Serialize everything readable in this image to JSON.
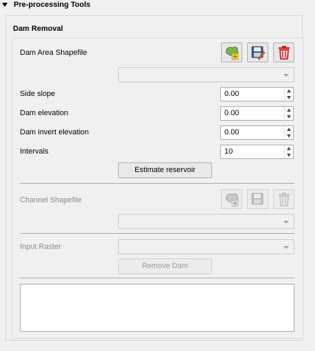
{
  "header": {
    "title": "Pre-processing Tools"
  },
  "group": {
    "title": "Dam Removal"
  },
  "dam_area": {
    "label": "Dam Area Shapefile",
    "combo_value": "",
    "icons": [
      "add-shapefile-icon",
      "save-shapefile-icon",
      "delete-icon"
    ]
  },
  "fields": [
    {
      "label": "Side slope",
      "value": "0.00"
    },
    {
      "label": "Dam elevation",
      "value": "0.00"
    },
    {
      "label": "Dam invert elevation",
      "value": "0.00"
    },
    {
      "label": "Intervals",
      "value": "10"
    }
  ],
  "estimate_button": "Estimate reservoir",
  "channel": {
    "label": "Channel Shapefile",
    "combo_value": "",
    "icons": [
      "add-shapefile-icon",
      "save-shapefile-icon",
      "delete-icon"
    ]
  },
  "input_raster": {
    "label": "Input Raster",
    "combo_value": ""
  },
  "remove_button": "Remove Dam",
  "log_text": "",
  "colors": {
    "accent_green": "#7ab648",
    "delete_red": "#d11a1a",
    "disk_blue": "#3a5b8c"
  }
}
